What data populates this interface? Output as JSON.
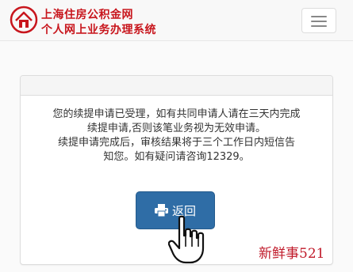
{
  "header": {
    "brand_line1": "上海住房公积金网",
    "brand_line2": "个人网上业务办理系统",
    "logo_icon": "house-logo-icon",
    "menu_icon": "hamburger-menu-icon"
  },
  "message": {
    "line1": "您的续提申请已受理，如有共同申请人请在三天内完成",
    "line2": "续提申请,否则该笔业务视为无效申请。",
    "line3": "续提申请完成后，审核结果将于三个工作日内短信告",
    "line4": "知您。如有疑问请咨询12329。"
  },
  "back_button": {
    "label": "返回",
    "icon": "printer-icon"
  },
  "watermark": "新鲜事521",
  "colors": {
    "brand": "#c8161d",
    "button": "#2f6da6"
  }
}
